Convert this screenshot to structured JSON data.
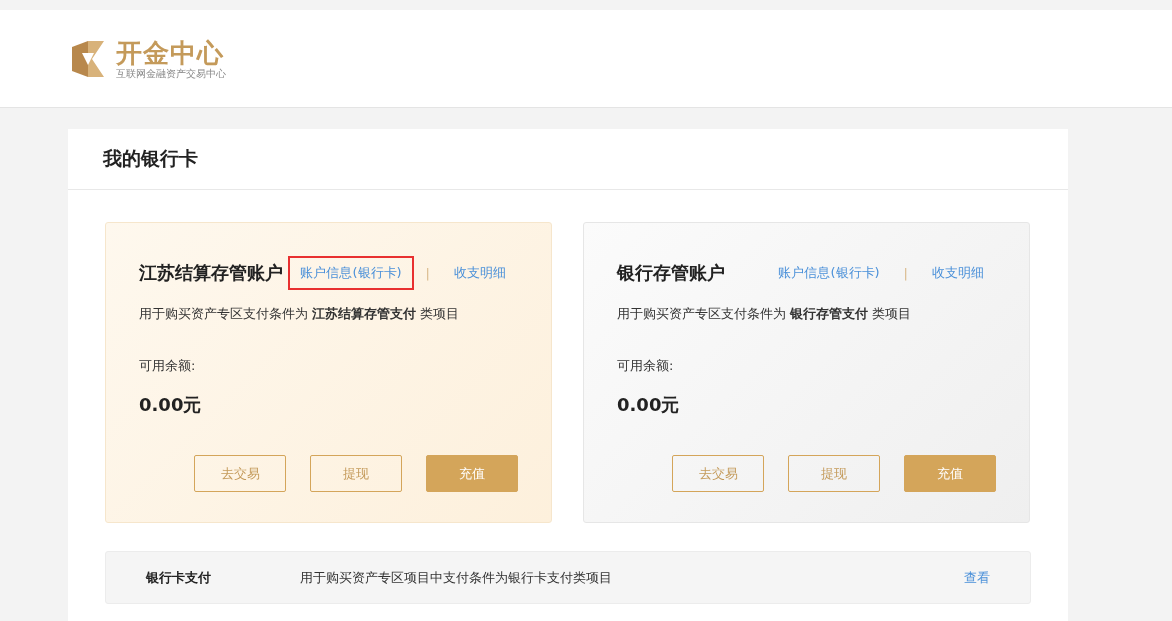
{
  "header": {
    "logo_title": "开金中心",
    "logo_subtitle": "互联网金融资产交易中心"
  },
  "page_title": "我的银行卡",
  "accounts": [
    {
      "kind": "gold",
      "name": "江苏结算存管账户",
      "links": [
        {
          "label": "账户信息(银行卡)",
          "highlighted": true
        },
        {
          "label": "收支明细",
          "highlighted": false
        }
      ],
      "separator": "|",
      "description": "用于购买资产专区支付条件为 **江苏结算存管支付** 类项目",
      "balance_label": "可用余额:",
      "balance": "0.00元",
      "buttons": [
        {
          "label": "去交易",
          "kind": "outline"
        },
        {
          "label": "提现",
          "kind": "outline"
        },
        {
          "label": "充值",
          "kind": "filled"
        }
      ]
    },
    {
      "kind": "gray",
      "name": "银行存管账户",
      "links": [
        {
          "label": "账户信息(银行卡)",
          "highlighted": false
        },
        {
          "label": "收支明细",
          "highlighted": false
        }
      ],
      "separator": "|",
      "description": "用于购买资产专区支付条件为 **银行存管支付** 类项目",
      "balance_label": "可用余额:",
      "balance": "0.00元",
      "buttons": [
        {
          "label": "去交易",
          "kind": "outline"
        },
        {
          "label": "提现",
          "kind": "outline"
        },
        {
          "label": "充值",
          "kind": "filled"
        }
      ]
    }
  ],
  "payment_row": {
    "name": "银行卡支付",
    "description": "用于购买资产专区项目中支付条件为银行卡支付类项目",
    "action": "查看"
  }
}
